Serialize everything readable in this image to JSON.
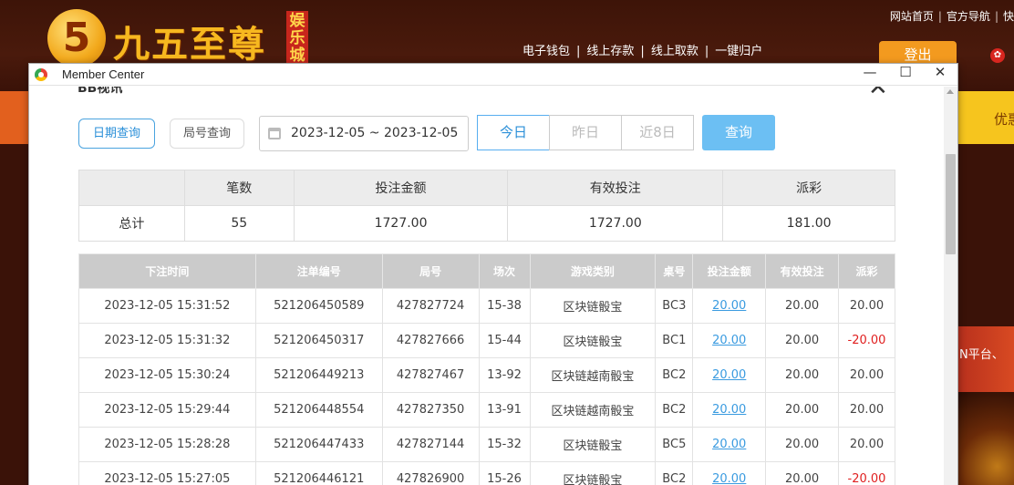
{
  "site": {
    "logo_digit": "5",
    "logo_text": "九五至尊",
    "logo_badge": "娱乐城",
    "top_links": [
      "网站首页",
      "官方导航",
      "快"
    ],
    "mid_links": [
      "电子钱包",
      "线上存款",
      "线上取款",
      "一键归户"
    ],
    "login_label": "登出",
    "nav_right_label": "优惠",
    "promo_text": "N平台、"
  },
  "window": {
    "title": "Member Center",
    "minimize": "—",
    "maximize": "☐",
    "close": "✕"
  },
  "panel": {
    "title": "BB视讯",
    "close": "✕"
  },
  "filters": {
    "by_date": "日期查询",
    "by_round": "局号查询",
    "date_range": "2023-12-05 ~ 2023-12-05",
    "today": "今日",
    "yesterday": "昨日",
    "last8": "近8日",
    "query": "查询"
  },
  "summary": {
    "headers": [
      "",
      "笔数",
      "投注金额",
      "有效投注",
      "派彩"
    ],
    "row": [
      "总计",
      "55",
      "1727.00",
      "1727.00",
      "181.00"
    ]
  },
  "detail": {
    "headers": [
      "下注时间",
      "注单编号",
      "局号",
      "场次",
      "游戏类别",
      "桌号",
      "投注金额",
      "有效投注",
      "派彩"
    ],
    "rows": [
      [
        "2023-12-05 15:31:52",
        "521206450589",
        "427827724",
        "15-38",
        "区块链骰宝",
        "BC3",
        "20.00",
        "20.00",
        "20.00"
      ],
      [
        "2023-12-05 15:31:32",
        "521206450317",
        "427827666",
        "15-44",
        "区块链骰宝",
        "BC1",
        "20.00",
        "20.00",
        "-20.00"
      ],
      [
        "2023-12-05 15:30:24",
        "521206449213",
        "427827467",
        "13-92",
        "区块链越南骰宝",
        "BC2",
        "20.00",
        "20.00",
        "20.00"
      ],
      [
        "2023-12-05 15:29:44",
        "521206448554",
        "427827350",
        "13-91",
        "区块链越南骰宝",
        "BC2",
        "20.00",
        "20.00",
        "20.00"
      ],
      [
        "2023-12-05 15:28:28",
        "521206447433",
        "427827144",
        "15-32",
        "区块链骰宝",
        "BC5",
        "20.00",
        "20.00",
        "20.00"
      ],
      [
        "2023-12-05 15:27:05",
        "521206446121",
        "427826900",
        "15-26",
        "区块链骰宝",
        "BC2",
        "20.00",
        "20.00",
        "-20.00"
      ]
    ]
  },
  "colors": {
    "accent": "#2a8fd8",
    "query_button": "#6cbff3",
    "negative": "#e02020",
    "link_amount": "#3a9be0"
  }
}
